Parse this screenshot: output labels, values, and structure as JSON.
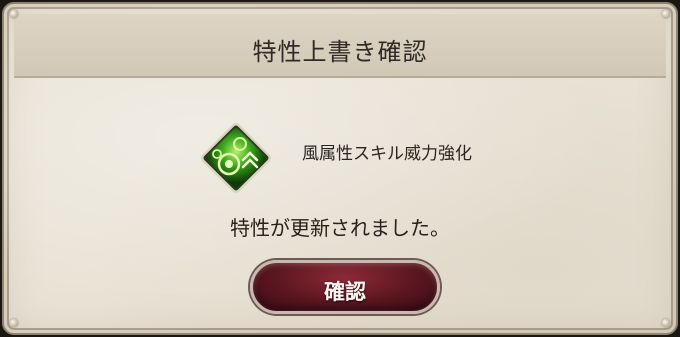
{
  "dialog": {
    "title": "特性上書き確認",
    "trait": {
      "icon": "wind-trait-icon",
      "name": "風属性スキル威力強化"
    },
    "message": "特性が更新されました。",
    "confirm_label": "確認"
  },
  "colors": {
    "panel": "#e9e3d6",
    "title_bar": "#d6cdbc",
    "button": "#5a1620",
    "icon_green": "#4fc02a"
  }
}
